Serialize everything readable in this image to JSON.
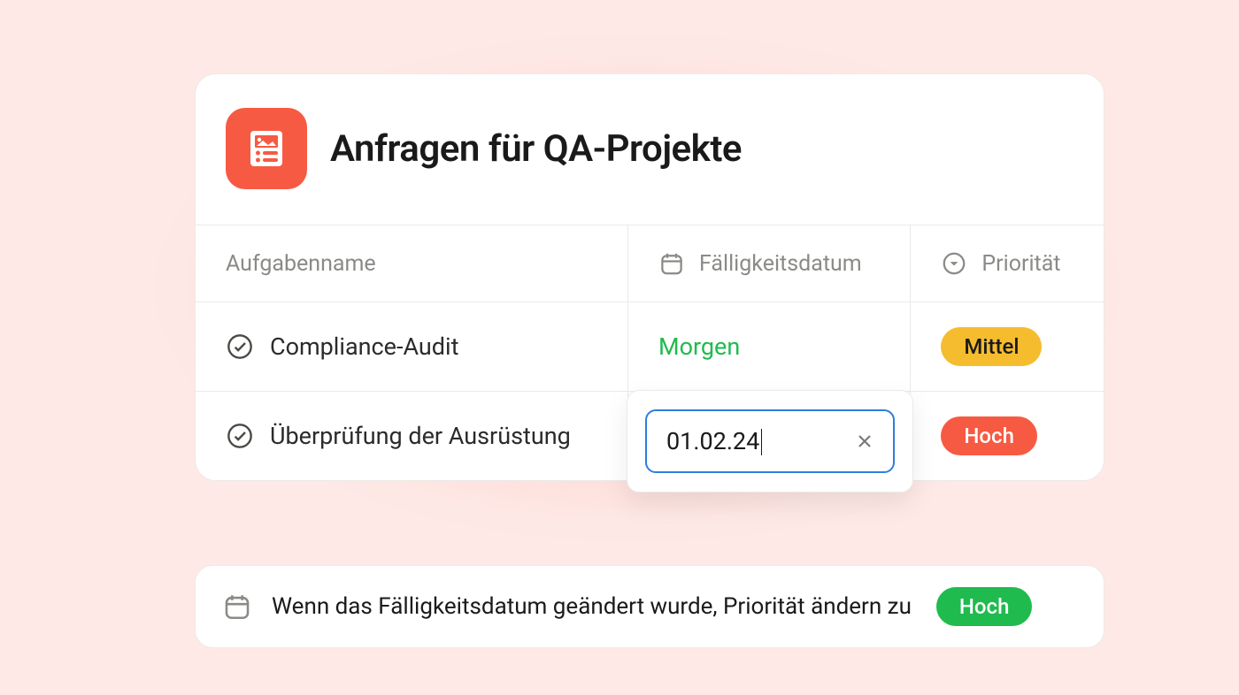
{
  "header": {
    "title": "Anfragen für QA-Projekte"
  },
  "columns": {
    "name": "Aufgabenname",
    "due": "Fälligkeitsdatum",
    "priority": "Priorität"
  },
  "tasks": [
    {
      "name": "Compliance-Audit",
      "due": "Morgen",
      "priority": "Mittel"
    },
    {
      "name": "Überprüfung der Ausrüstung",
      "due_input": "01.02.24",
      "priority": "Hoch"
    }
  ],
  "automation": {
    "text": "Wenn das Fälligkeitsdatum geändert wurde, Priorität ändern zu",
    "target_priority": "Hoch"
  }
}
